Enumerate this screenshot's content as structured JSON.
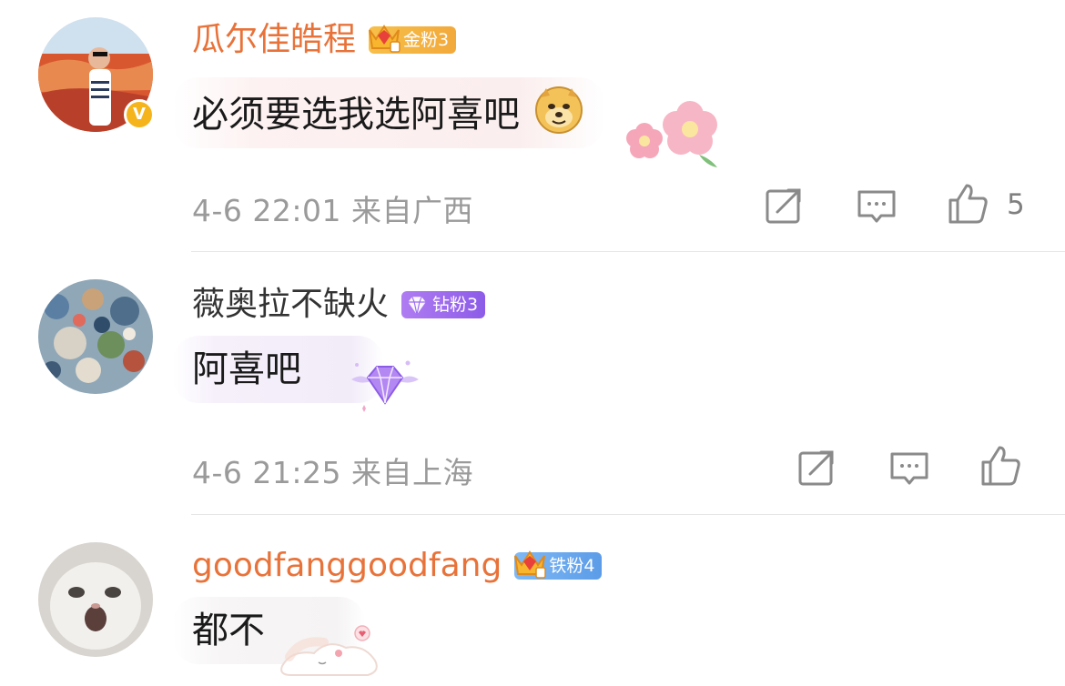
{
  "comments": [
    {
      "username": "瓜尔佳皓程",
      "badge": "金粉3",
      "badge_type": "gold",
      "text": "必须要选我选阿喜吧",
      "emoji": "doge-emoji",
      "decoration": "pink-flowers",
      "time": "4-6 22:01",
      "location": "来自广西",
      "likes": "5",
      "verified": true
    },
    {
      "username": "薇奥拉不缺火",
      "badge": "钻粉3",
      "badge_type": "diamond",
      "text": "阿喜吧",
      "decoration": "winged-diamond",
      "time": "4-6 21:25",
      "location": "来自上海",
      "likes": ""
    },
    {
      "username": "goodfanggoodfang",
      "badge": "铁粉4",
      "badge_type": "iron",
      "text": "都不",
      "decoration": "sleeping-cat"
    }
  ],
  "colors": {
    "username_orange": "#e8733a",
    "meta_gray": "#9a9a9a",
    "gold_badge": "#f2a93b",
    "diamond_badge": "#8c5ce8",
    "iron_badge": "#5c9ce8"
  }
}
